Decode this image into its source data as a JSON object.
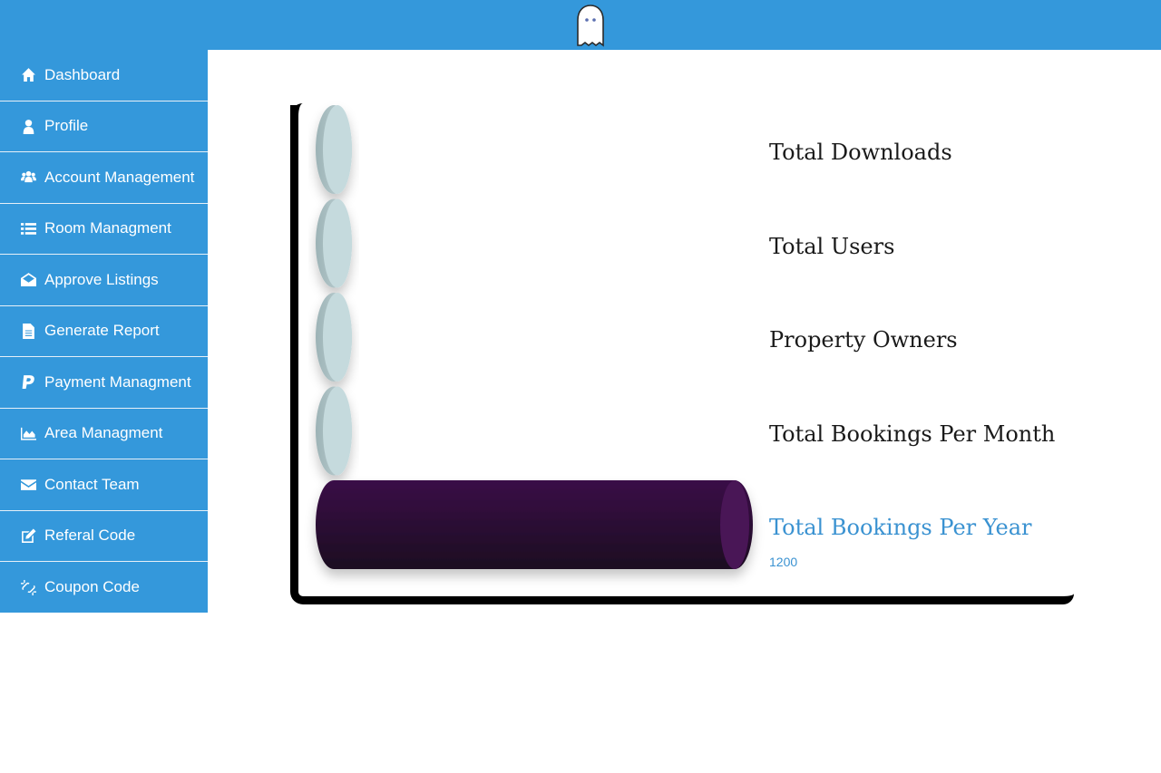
{
  "sidebar": {
    "items": [
      {
        "label": "Dashboard",
        "icon": "home-icon"
      },
      {
        "label": "Profile",
        "icon": "user-icon"
      },
      {
        "label": "Account Management",
        "icon": "users-icon"
      },
      {
        "label": "Room Managment",
        "icon": "list-icon"
      },
      {
        "label": "Approve Listings",
        "icon": "envelope-open-icon"
      },
      {
        "label": "Generate Report",
        "icon": "file-text-icon"
      },
      {
        "label": "Payment Managment",
        "icon": "paypal-icon"
      },
      {
        "label": "Area Managment",
        "icon": "area-chart-icon"
      },
      {
        "label": "Contact Team",
        "icon": "envelope-icon"
      },
      {
        "label": "Referal Code",
        "icon": "edit-icon"
      },
      {
        "label": "Coupon Code",
        "icon": "unlink-icon"
      }
    ]
  },
  "colors": {
    "header": "#3498db",
    "sidebar": "#3498db",
    "inactive_bar": "#c5dadd",
    "active_bar": "#2c0b36",
    "active_label": "#3a92d1"
  },
  "chart_data": {
    "type": "bar",
    "orientation": "horizontal",
    "categories": [
      "Total Downloads",
      "Total Users",
      "Property Owners",
      "Total Bookings Per Month",
      "Total Bookings Per Year"
    ],
    "values": [
      0,
      0,
      0,
      0,
      1200
    ],
    "xlim": [
      0,
      1200
    ],
    "active_index": 4,
    "active_value_label": "1200"
  }
}
